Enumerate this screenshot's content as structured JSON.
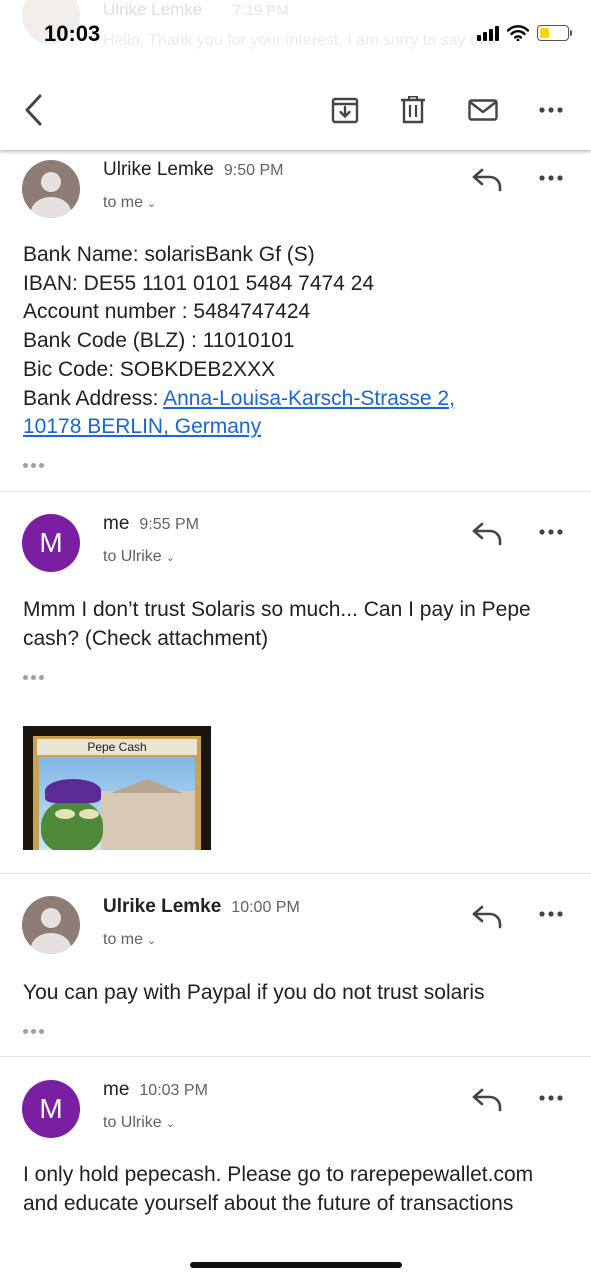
{
  "status_bar": {
    "time": "10:03"
  },
  "background_preview": {
    "sender": "Ulrike Lemke",
    "time": "7:19 PM",
    "snippet": "Hello, Thank you for your interest, I am sorry to say that"
  },
  "toolbar": {
    "back_icon": "chevron-left-icon",
    "archive_icon": "archive-icon",
    "delete_icon": "trash-icon",
    "mark_unread_icon": "mail-icon",
    "more_icon": "more-horizontal-icon"
  },
  "messages": [
    {
      "sender": "Ulrike Lemke",
      "time": "9:50 PM",
      "recipient": "to me",
      "avatar": "person-avatar",
      "body_lines": [
        "Bank Name: solarisBank Gf (S)",
        "IBAN: DE55 1101 0101 5484 7474 24",
        "Account number : 5484747424",
        "Bank Code (BLZ) : 11010101",
        "Bic Code: SOBKDEB2XXX"
      ],
      "address_label": "Bank Address: ",
      "address_link_line1": "Anna-Louisa-Karsch-Strasse 2,",
      "address_link_line2": "10178 BERLIN, Germany"
    },
    {
      "sender": "me",
      "time": "9:55 PM",
      "recipient": "to Ulrike",
      "avatar_letter": "M",
      "body": "Mmm I don’t trust Solaris so much... Can I pay in Pepe cash?  (Check attachment)",
      "attachment": {
        "card_title": "Pepe Cash"
      }
    },
    {
      "sender": "Ulrike Lemke",
      "time": "10:00 PM",
      "recipient": "to me",
      "avatar": "person-avatar",
      "body": "You can pay with Paypal if you do not trust solaris"
    },
    {
      "sender": "me",
      "time": "10:03 PM",
      "recipient": "to Ulrike",
      "avatar_letter": "M",
      "body": "I only hold pepecash. Please go to rarepepewallet.com and educate yourself about the future of transactions"
    }
  ],
  "colors": {
    "accent_purple": "#7a1fa2",
    "link_blue": "#1a66d2",
    "battery_yellow": "#f5d60a"
  }
}
